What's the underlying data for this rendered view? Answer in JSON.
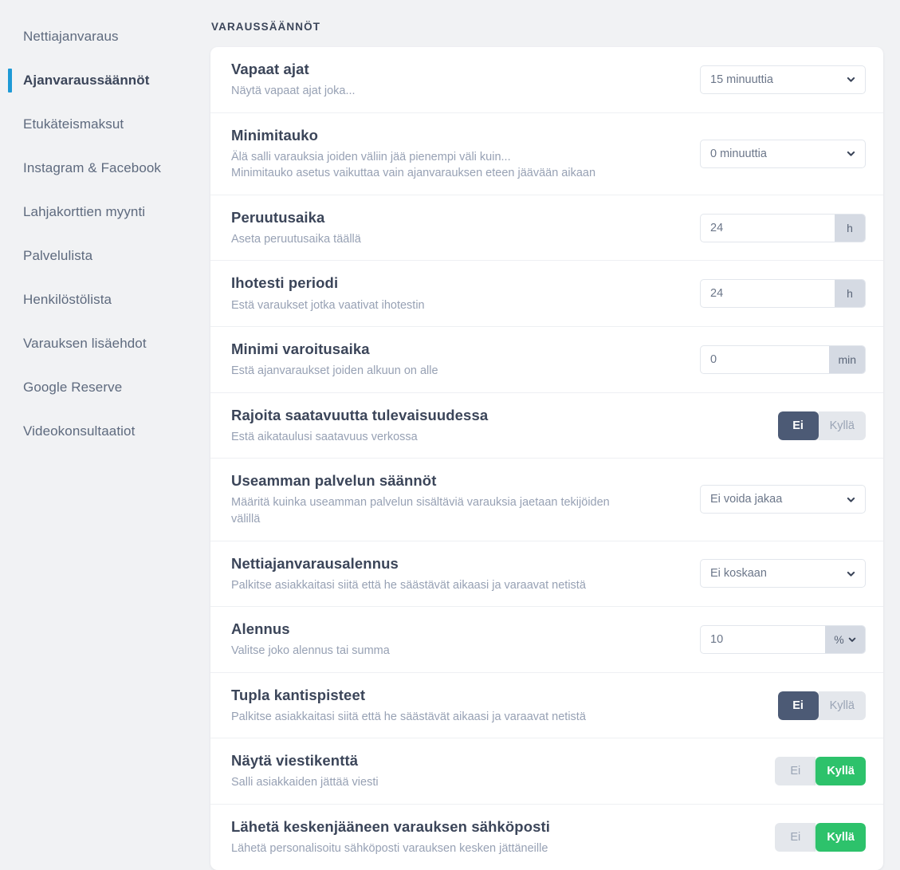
{
  "sidebar": {
    "items": [
      {
        "label": "Nettiajanvaraus",
        "active": false
      },
      {
        "label": "Ajanvaraussäännöt",
        "active": true
      },
      {
        "label": "Etukäteismaksut",
        "active": false
      },
      {
        "label": "Instagram & Facebook",
        "active": false
      },
      {
        "label": "Lahjakorttien myynti",
        "active": false
      },
      {
        "label": "Palvelulista",
        "active": false
      },
      {
        "label": "Henkilöstölista",
        "active": false
      },
      {
        "label": "Varauksen lisäehdot",
        "active": false
      },
      {
        "label": "Google Reserve",
        "active": false
      },
      {
        "label": "Videokonsultaatiot",
        "active": false
      }
    ]
  },
  "main": {
    "section_title": "VARAUSSÄÄNNÖT",
    "rows": [
      {
        "title": "Vapaat ajat",
        "desc": [
          "Näytä vapaat ajat joka..."
        ],
        "control": {
          "type": "select",
          "value": "15 minuuttia"
        }
      },
      {
        "title": "Minimitauko",
        "desc": [
          "Älä salli varauksia joiden väliin jää pienempi väli kuin...",
          "Minimitauko asetus vaikuttaa vain ajanvarauksen eteen jäävään aikaan"
        ],
        "control": {
          "type": "select",
          "value": "0 minuuttia"
        }
      },
      {
        "title": "Peruutusaika",
        "desc": [
          "Aseta peruutusaika täällä"
        ],
        "control": {
          "type": "input",
          "value": "24",
          "suffix": "h"
        }
      },
      {
        "title": "Ihotesti periodi",
        "desc": [
          "Estä varaukset jotka vaativat ihotestin"
        ],
        "control": {
          "type": "input",
          "value": "24",
          "suffix": "h"
        }
      },
      {
        "title": "Minimi varoitusaika",
        "desc": [
          "Estä ajanvaraukset joiden alkuun on alle"
        ],
        "control": {
          "type": "input",
          "value": "0",
          "suffix": "min"
        }
      },
      {
        "title": "Rajoita saatavuutta tulevaisuudessa",
        "desc": [
          "Estä aikataulusi saatavuus verkossa"
        ],
        "control": {
          "type": "toggle",
          "no_label": "Ei",
          "yes_label": "Kyllä",
          "selected": "no"
        }
      },
      {
        "title": "Useamman palvelun säännöt",
        "desc": [
          "Määritä kuinka useamman palvelun sisältäviä varauksia jaetaan tekijöiden",
          "välillä"
        ],
        "control": {
          "type": "select",
          "value": "Ei voida jakaa"
        }
      },
      {
        "title": "Nettiajanvarausalennus",
        "desc": [
          "Palkitse asiakkaitasi siitä että he säästävät aikaasi ja varaavat netistä"
        ],
        "control": {
          "type": "select",
          "value": "Ei koskaan"
        }
      },
      {
        "title": "Alennus",
        "desc": [
          "Valitse joko alennus tai summa"
        ],
        "control": {
          "type": "input",
          "value": "10",
          "suffix": "%",
          "suffix_dropdown": true
        }
      },
      {
        "title": "Tupla kantispisteet",
        "desc": [
          "Palkitse asiakkaitasi siitä että he säästävät aikaasi ja varaavat netistä"
        ],
        "control": {
          "type": "toggle",
          "no_label": "Ei",
          "yes_label": "Kyllä",
          "selected": "no"
        }
      },
      {
        "title": "Näytä viestikenttä",
        "desc": [
          "Salli asiakkaiden jättää viesti"
        ],
        "control": {
          "type": "toggle",
          "no_label": "Ei",
          "yes_label": "Kyllä",
          "selected": "yes"
        }
      },
      {
        "title": "Lähetä keskenjääneen varauksen sähköposti",
        "desc": [
          "Lähetä personalisoitu sähköposti varauksen kesken jättäneille"
        ],
        "control": {
          "type": "toggle",
          "no_label": "Ei",
          "yes_label": "Kyllä",
          "selected": "yes"
        }
      }
    ]
  },
  "colors": {
    "accent": "#1e9ad6",
    "toggle_on_green": "#2dc26b",
    "toggle_on_slate": "#4c5a75",
    "page_background": "#f1f2f4",
    "title_text": "#3b4559",
    "muted_text": "#97a1b4"
  }
}
